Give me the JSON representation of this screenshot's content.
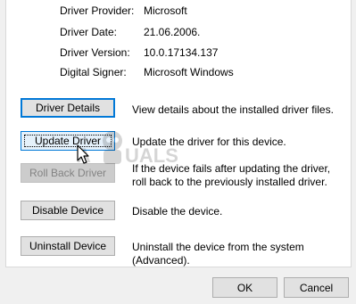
{
  "properties": [
    {
      "label": "Driver Provider:",
      "value": "Microsoft"
    },
    {
      "label": "Driver Date:",
      "value": "21.06.2006."
    },
    {
      "label": "Driver Version:",
      "value": "10.0.17134.137"
    },
    {
      "label": "Digital Signer:",
      "value": "Microsoft Windows"
    }
  ],
  "actions": {
    "details": {
      "label": "Driver Details",
      "description": "View details about the installed driver files."
    },
    "update": {
      "label": "Update Driver",
      "description": "Update the driver for this device."
    },
    "rollback": {
      "label": "Roll Back Driver",
      "description": "If the device fails after updating the driver, roll back to the previously installed driver."
    },
    "disable": {
      "label": "Disable Device",
      "description": "Disable the device."
    },
    "uninstall": {
      "label": "Uninstall Device",
      "description": "Uninstall the device from the system (Advanced)."
    }
  },
  "footer": {
    "ok_label": "OK",
    "cancel_label": "Cancel"
  },
  "watermark": {
    "text": "APPUALS"
  },
  "icons": {
    "cursor": "mouse-pointer-icon",
    "mascot": "appuals-mascot-icon"
  },
  "colors": {
    "focus_border": "#0078d7",
    "button_face": "#e1e1e1",
    "disabled_text": "#838383"
  }
}
